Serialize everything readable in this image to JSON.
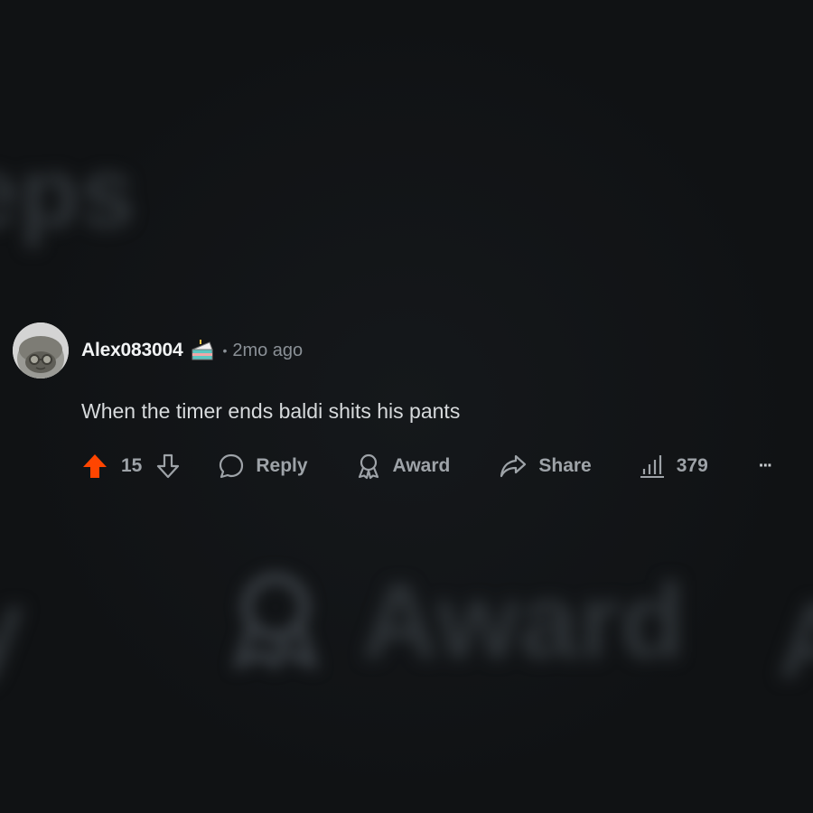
{
  "background": {
    "top_blur_text": "eps",
    "bottom_blur_left_text": "y",
    "bottom_blur_award_text": "Award",
    "bottom_blur_right_text": "A"
  },
  "comment": {
    "username": "Alex083004",
    "separator": "•",
    "timestamp": "2mo ago",
    "body": "When the timer ends baldi shits his pants",
    "vote_count": "15",
    "reply_label": "Reply",
    "award_label": "Award",
    "share_label": "Share",
    "views_count": "379",
    "more_label": "···"
  },
  "colors": {
    "background": "#101214",
    "upvote_active": "#ff4500",
    "text_primary": "#d7dadc",
    "text_muted": "#9ea3a8"
  },
  "icons": {
    "upvote": "arrow-up-icon",
    "downvote": "arrow-down-icon",
    "reply": "speech-bubble-icon",
    "award": "award-ribbon-icon",
    "share": "share-arrow-icon",
    "views": "bar-chart-icon",
    "more": "ellipsis-icon",
    "flair": "cake-icon"
  }
}
